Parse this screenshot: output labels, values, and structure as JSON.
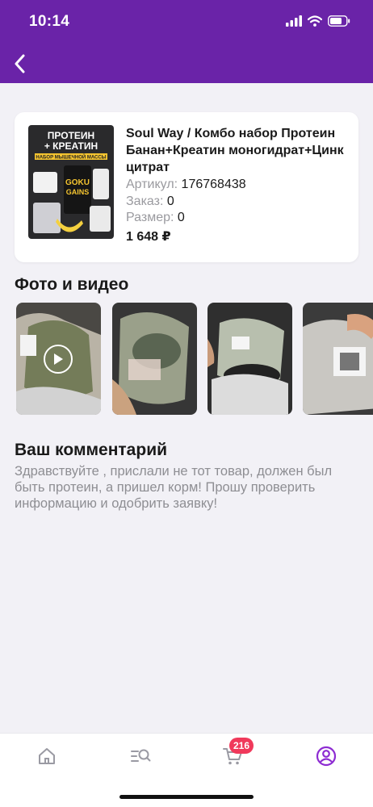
{
  "status_bar": {
    "time": "10:14"
  },
  "product": {
    "thumb_headline": "ПРОТЕИН + КРЕАТИН",
    "thumb_subline": "НАБОР МЫШЕЧНОЙ МАССЫ",
    "thumb_brand": "GOKU GAINS",
    "title": "Soul Way / Комбо набор Протеин Банан+Креатин моногидрат+Цинк цитрат",
    "article_label": "Артикул:",
    "article_value": "176768438",
    "order_label": "Заказ:",
    "order_value": "0",
    "size_label": "Размер:",
    "size_value": "0",
    "price": "1 648 ₽"
  },
  "media_section": {
    "title": "Фото и видео"
  },
  "comment_section": {
    "title": "Ваш комментарий",
    "text": "Здравствуйте , прислали не тот товар, должен был быть протеин, а пришел корм! Прошу проверить информацию и одобрить заявку!"
  },
  "tabbar": {
    "cart_badge": "216"
  },
  "colors": {
    "brand": "#6a23a8",
    "badge": "#f0395b",
    "active_tab": "#8d2bd2"
  }
}
